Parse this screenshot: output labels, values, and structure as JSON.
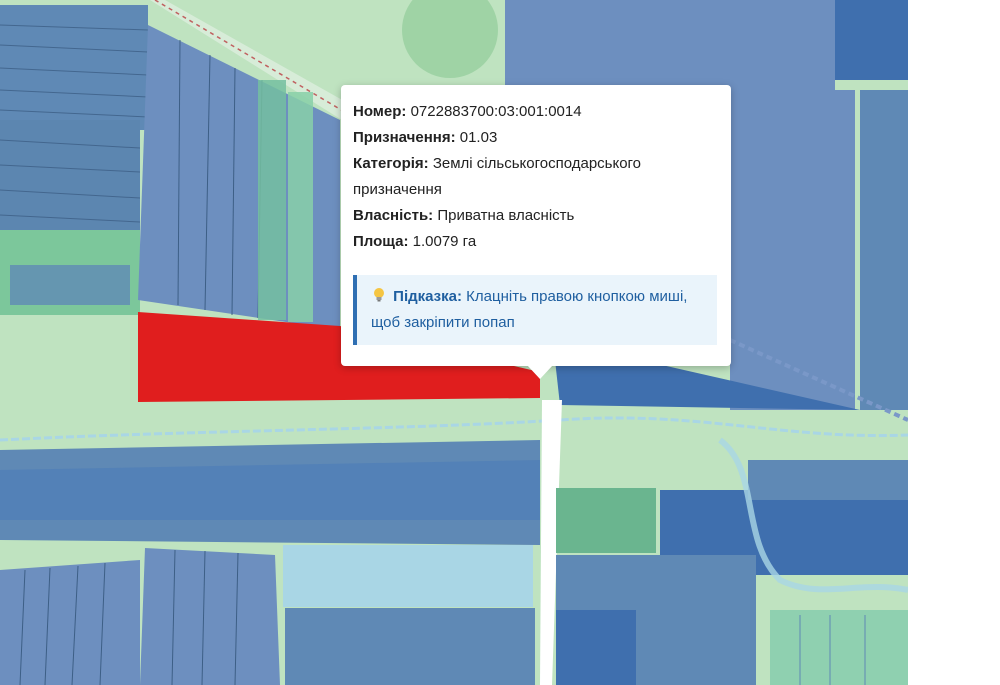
{
  "popup": {
    "number_label": "Номер:",
    "number_value": "0722883700:03:001:0014",
    "purpose_label": "Призначення:",
    "purpose_value": "01.03",
    "category_label": "Категорія:",
    "category_value": "Землі сільськогосподарського призначення",
    "ownership_label": "Власність:",
    "ownership_value": "Приватна власність",
    "area_label": "Площа:",
    "area_value": "1.0079 га",
    "hint_label": "Підказка:",
    "hint_text": "Клацніть правою кнопкою миші, щоб закріпити попап",
    "hint_icon": "lightbulb-icon"
  },
  "map": {
    "colors": {
      "parcel_blue": "#5f89b5",
      "parcel_dark_blue": "#3f6fae",
      "parcel_teal": "#6fb3a0",
      "meadow_green": "#bfe3c0",
      "selected_parcel": "#e01e1e",
      "road": "#ffffff",
      "water": "#a9d6e5"
    }
  }
}
